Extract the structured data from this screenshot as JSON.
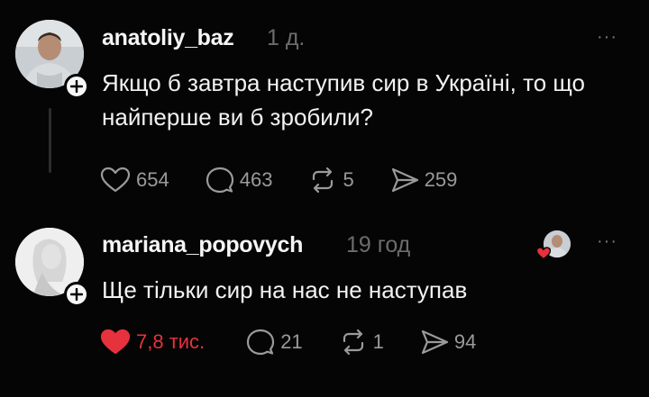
{
  "posts": [
    {
      "username": "anatoliy_baz",
      "time": "1 д.",
      "text": "Якщо б завтра наступив сир в Україні, то що найперше ви б зробили?",
      "likes": "654",
      "replies": "463",
      "reposts": "5",
      "shares": "259"
    },
    {
      "username": "mariana_popovych",
      "time": "19 год",
      "text": "Ще тільки сир на нас не наступав",
      "likes": "7,8 тис.",
      "replies": "21",
      "reposts": "1",
      "shares": "94"
    }
  ],
  "more_glyph": "···",
  "colors": {
    "liked": "#e5323c",
    "muted": "#9a9a9a",
    "background": "#050505"
  },
  "icons": [
    "heart-icon",
    "comment-icon",
    "repost-icon",
    "share-icon",
    "plus-icon",
    "more-icon"
  ]
}
